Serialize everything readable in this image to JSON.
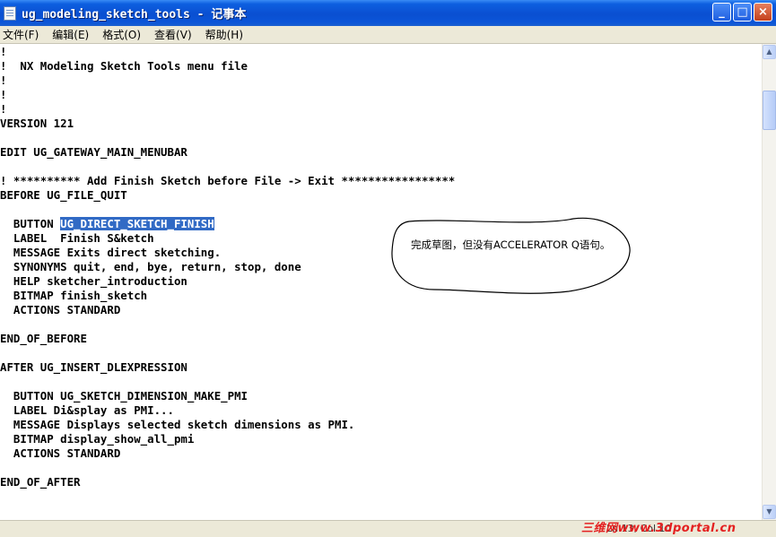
{
  "window": {
    "title": "ug_modeling_sketch_tools - 记事本",
    "buttons": [
      "_",
      "□",
      "×"
    ]
  },
  "menubar": [
    {
      "label": "文件(F)"
    },
    {
      "label": "编辑(E)"
    },
    {
      "label": "格式(O)"
    },
    {
      "label": "查看(V)"
    },
    {
      "label": "帮助(H)"
    }
  ],
  "editor": {
    "lines": [
      {
        "text": "!"
      },
      {
        "text": "!  NX Modeling Sketch Tools menu file"
      },
      {
        "text": "!"
      },
      {
        "text": "!"
      },
      {
        "text": "!"
      },
      {
        "text": "VERSION 121"
      },
      {
        "text": ""
      },
      {
        "text": "EDIT UG_GATEWAY_MAIN_MENUBAR"
      },
      {
        "text": ""
      },
      {
        "text": "! ********** Add Finish Sketch before File -> Exit *****************"
      },
      {
        "text": "BEFORE UG_FILE_QUIT"
      },
      {
        "text": ""
      },
      {
        "text": "  BUTTON ",
        "selected": "UG_DIRECT_SKETCH_FINISH"
      },
      {
        "text": "  LABEL  Finish S&ketch"
      },
      {
        "text": "  MESSAGE Exits direct sketching."
      },
      {
        "text": "  SYNONYMS quit, end, bye, return, stop, done"
      },
      {
        "text": "  HELP sketcher_introduction"
      },
      {
        "text": "  BITMAP finish_sketch"
      },
      {
        "text": "  ACTIONS STANDARD"
      },
      {
        "text": ""
      },
      {
        "text": "END_OF_BEFORE"
      },
      {
        "text": ""
      },
      {
        "text": "AFTER UG_INSERT_DLEXPRESSION"
      },
      {
        "text": ""
      },
      {
        "text": "  BUTTON UG_SKETCH_DIMENSION_MAKE_PMI"
      },
      {
        "text": "  LABEL Di&splay as PMI..."
      },
      {
        "text": "  MESSAGE Displays selected sketch dimensions as PMI."
      },
      {
        "text": "  BITMAP display_show_all_pmi"
      },
      {
        "text": "  ACTIONS STANDARD"
      },
      {
        "text": ""
      },
      {
        "text": "END_OF_AFTER"
      }
    ]
  },
  "annotation": {
    "text": "完成草图，但没有ACCELERATOR Q语句。"
  },
  "statusbar": {
    "position": "Ln 13, Col 10"
  },
  "watermark": {
    "text": "三维网www.3dportal.cn"
  },
  "colors": {
    "titlebar": "#0a4fd1",
    "selection": "#316ac5",
    "menubar": "#ece9d8",
    "watermark": "#e42020"
  },
  "icons": [
    "notepad-icon",
    "minimize-icon",
    "maximize-icon",
    "close-icon",
    "scroll-up-icon",
    "scroll-down-icon"
  ]
}
